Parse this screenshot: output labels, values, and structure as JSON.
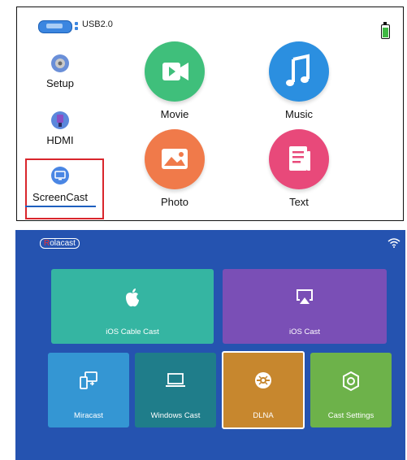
{
  "top_panel": {
    "usb_label": "USB2.0",
    "sidebar": [
      {
        "label": "Setup",
        "icon": "gear-icon"
      },
      {
        "label": "HDMI",
        "icon": "hdmi-cable-icon"
      },
      {
        "label": "ScreenCast",
        "icon": "screen-cast-icon",
        "selected": true
      }
    ],
    "apps": [
      {
        "label": "Movie",
        "icon": "video-camera-icon",
        "color": "#3fbf7b"
      },
      {
        "label": "Music",
        "icon": "music-note-icon",
        "color": "#2b8fe0"
      },
      {
        "label": "Photo",
        "icon": "image-icon",
        "color": "#f07a4a"
      },
      {
        "label": "Text",
        "icon": "document-icon",
        "color": "#e8497a"
      }
    ],
    "battery_level": 0.75
  },
  "bottom_panel": {
    "brand": {
      "first": "R",
      "rest": "olacast"
    },
    "tiles": [
      {
        "label": "iOS Cable Cast",
        "icon": "apple-icon",
        "color": "#35b5a2"
      },
      {
        "label": "iOS Cast",
        "icon": "airplay-icon",
        "color": "#7a4fb6"
      },
      {
        "label": "Miracast",
        "icon": "devices-icon",
        "color": "#3496d3"
      },
      {
        "label": "Windows Cast",
        "icon": "laptop-icon",
        "color": "#1f7d8a"
      },
      {
        "label": "DLNA",
        "icon": "dlna-icon",
        "color": "#c7872e",
        "selected": true
      },
      {
        "label": "Cast Settings",
        "icon": "settings-hexagon-icon",
        "color": "#6db24a"
      }
    ]
  }
}
